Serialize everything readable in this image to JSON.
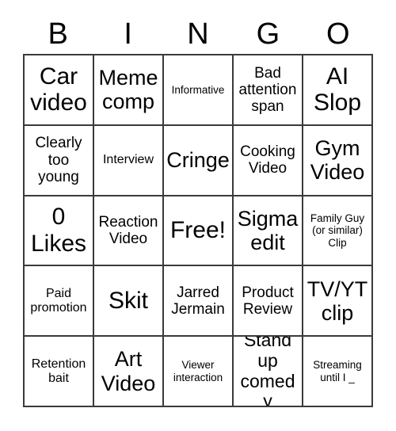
{
  "card": {
    "title": "BINGO",
    "header_letters": [
      "B",
      "I",
      "N",
      "G",
      "O"
    ],
    "free_space_label": "Free!",
    "colors": {
      "grid_line": "#3a3a3a",
      "text": "#000000",
      "background": "#ffffff"
    },
    "rows": [
      [
        {
          "text": "Car video",
          "size": "xxl"
        },
        {
          "text": "Meme comp",
          "size": "xl"
        },
        {
          "text": "Informative",
          "size": "xs"
        },
        {
          "text": "Bad attention span",
          "size": "md"
        },
        {
          "text": "AI Slop",
          "size": "xxl"
        }
      ],
      [
        {
          "text": "Clearly too young",
          "size": "md"
        },
        {
          "text": "Interview",
          "size": "sm"
        },
        {
          "text": "Cringe",
          "size": "xl"
        },
        {
          "text": "Cooking Video",
          "size": "md"
        },
        {
          "text": "Gym Video",
          "size": "xl"
        }
      ],
      [
        {
          "text": "0 Likes",
          "size": "xxl"
        },
        {
          "text": "Reaction Video",
          "size": "md"
        },
        {
          "text": "Free!",
          "size": "xxl"
        },
        {
          "text": "Sigma edit",
          "size": "xl"
        },
        {
          "text": "Family Guy (or similar) Clip",
          "size": "xs"
        }
      ],
      [
        {
          "text": "Paid promotion",
          "size": "sm"
        },
        {
          "text": "Skit",
          "size": "xxl"
        },
        {
          "text": "Jarred Jermain",
          "size": "md"
        },
        {
          "text": "Product Review",
          "size": "md"
        },
        {
          "text": "TV/YT clip",
          "size": "xl"
        }
      ],
      [
        {
          "text": "Retention bait",
          "size": "sm"
        },
        {
          "text": "Art Video",
          "size": "xl"
        },
        {
          "text": "Viewer interaction",
          "size": "xs"
        },
        {
          "text": "Stand up comedy",
          "size": "lg"
        },
        {
          "text": "Streaming until I _",
          "size": "xs"
        }
      ]
    ]
  }
}
